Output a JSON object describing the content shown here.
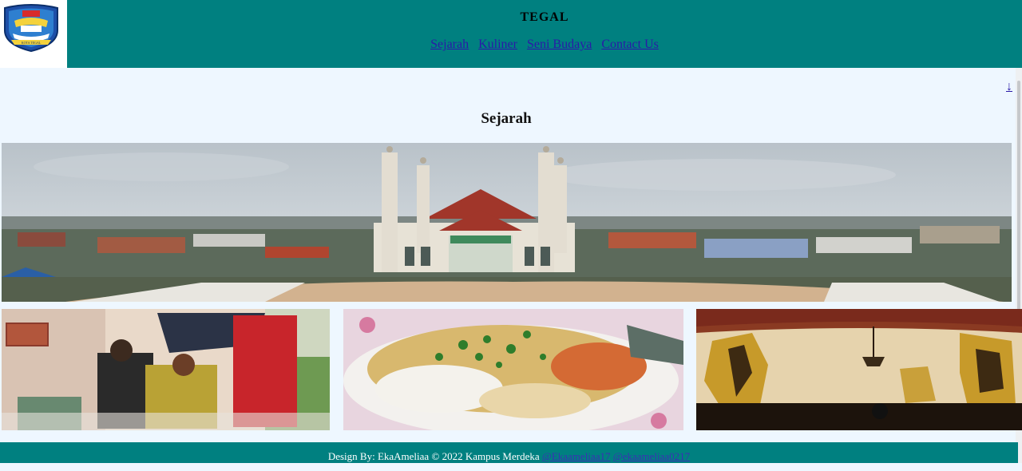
{
  "header": {
    "title": "TEGAL",
    "nav": [
      "Sejarah",
      "Kuliner",
      "Seni Budaya",
      "Contact Us"
    ]
  },
  "logo": {
    "text": "KOTA TEGAL"
  },
  "down_arrow": "↓",
  "section": {
    "title": "Sejarah"
  },
  "images": {
    "hero": "mosque-panorama",
    "thumbs": [
      "traditional-ceremony",
      "tegal-food",
      "wayang-shadow-puppets"
    ]
  },
  "footer": {
    "text": "Design By: EkaAmeliaa © 2022 Kampus Merdeka",
    "links": [
      "@Ekaameliaa17",
      "@ekaameliaa0217"
    ]
  },
  "colors": {
    "header": "#008080",
    "background": "#eef7ff",
    "link": "#2a1aa8"
  }
}
